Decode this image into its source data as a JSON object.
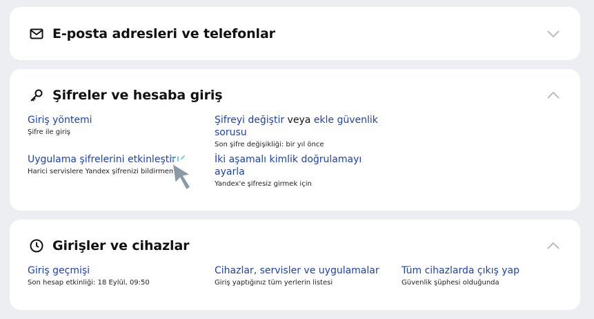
{
  "email_card": {
    "title": "E-posta adresleri ve telefonlar",
    "icon": "mail-icon",
    "expanded": false
  },
  "password_card": {
    "title": "Şifreler ve hesaba giriş",
    "icon": "key-icon",
    "expanded": true,
    "items": {
      "login_method": {
        "link": "Giriş yöntemi",
        "sub": "Şifre ile giriş"
      },
      "change_password": {
        "link1": "Şifreyi değiştir",
        "connector": " veya ",
        "link2": "ekle güvenlik sorusu",
        "sub": "Son şifre değişikliği: bir yıl önce"
      },
      "app_passwords": {
        "link": "Uygulama şifrelerini etkinleştir",
        "sub": "Harici servislere Yandex şifrenizi bildirmemek"
      },
      "two_factor": {
        "link": "İki aşamalı kimlik doğrulamayı ayarla",
        "sub": "Yandex'e şifresiz girmek için"
      }
    }
  },
  "logins_card": {
    "title": "Girişler ve cihazlar",
    "icon": "clock-icon",
    "expanded": true,
    "items": {
      "login_history": {
        "link": "Giriş geçmişi",
        "sub": "Son hesap etkinliği: 18 Eylül, 09:50"
      },
      "devices": {
        "link": "Cihazlar, servisler ve uygulamalar",
        "sub": "Giriş yaptığınız tüm yerlerin listesi"
      },
      "logout_all": {
        "link": "Tüm cihazlarda çıkış yap",
        "sub": "Güvenlik şüphesi olduğunda"
      }
    }
  },
  "colors": {
    "link": "#1a3fc0",
    "background": "#eceef2",
    "card": "#ffffff"
  }
}
